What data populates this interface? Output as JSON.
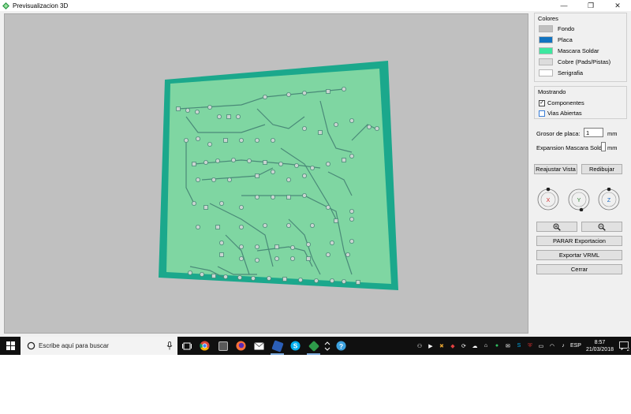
{
  "window": {
    "title": "Previsualizacion 3D",
    "minimize": "—",
    "maximize": "❐",
    "close": "✕"
  },
  "colors_group": {
    "title": "Colores",
    "items": [
      {
        "label": "Fondo",
        "color": "#c0c0c0"
      },
      {
        "label": "Placa",
        "color": "#1273c0"
      },
      {
        "label": "Mascara Soldar",
        "color": "#3de8a0"
      },
      {
        "label": "Cobre (Pads/Pistas)",
        "color": "#dcdcdc"
      },
      {
        "label": "Serigrafia",
        "color": "#ffffff"
      }
    ]
  },
  "showing_group": {
    "title": "Mostrando",
    "components_label": "Componentes",
    "components_checked": true,
    "vias_label": "Vias Abiertas",
    "vias_checked": false
  },
  "fields": {
    "thickness_label": "Grosor de placa:",
    "thickness_value": "1",
    "thickness_unit": "mm",
    "mask_label": "Expansion Mascara Sold.",
    "mask_value": "",
    "mask_unit": "mm"
  },
  "buttons": {
    "reset_view": "Reajustar Vista",
    "redraw": "Redibujar",
    "stop_export": "PARAR Exportacion",
    "export_vrml": "Exportar VRML",
    "close": "Cerrar"
  },
  "rotation": {
    "x": "X",
    "y": "Y",
    "z": "Z"
  },
  "taskbar": {
    "search_placeholder": "Escribe aquí para buscar",
    "language": "ESP",
    "time": "8:57",
    "date": "21/03/2018",
    "notification_count": "2"
  },
  "pcb": {
    "board_color": "#1ba88c",
    "mask_color": "#7fd6a2",
    "trace_color": "#4a8a78",
    "pad_color": "#c9d4d0"
  }
}
